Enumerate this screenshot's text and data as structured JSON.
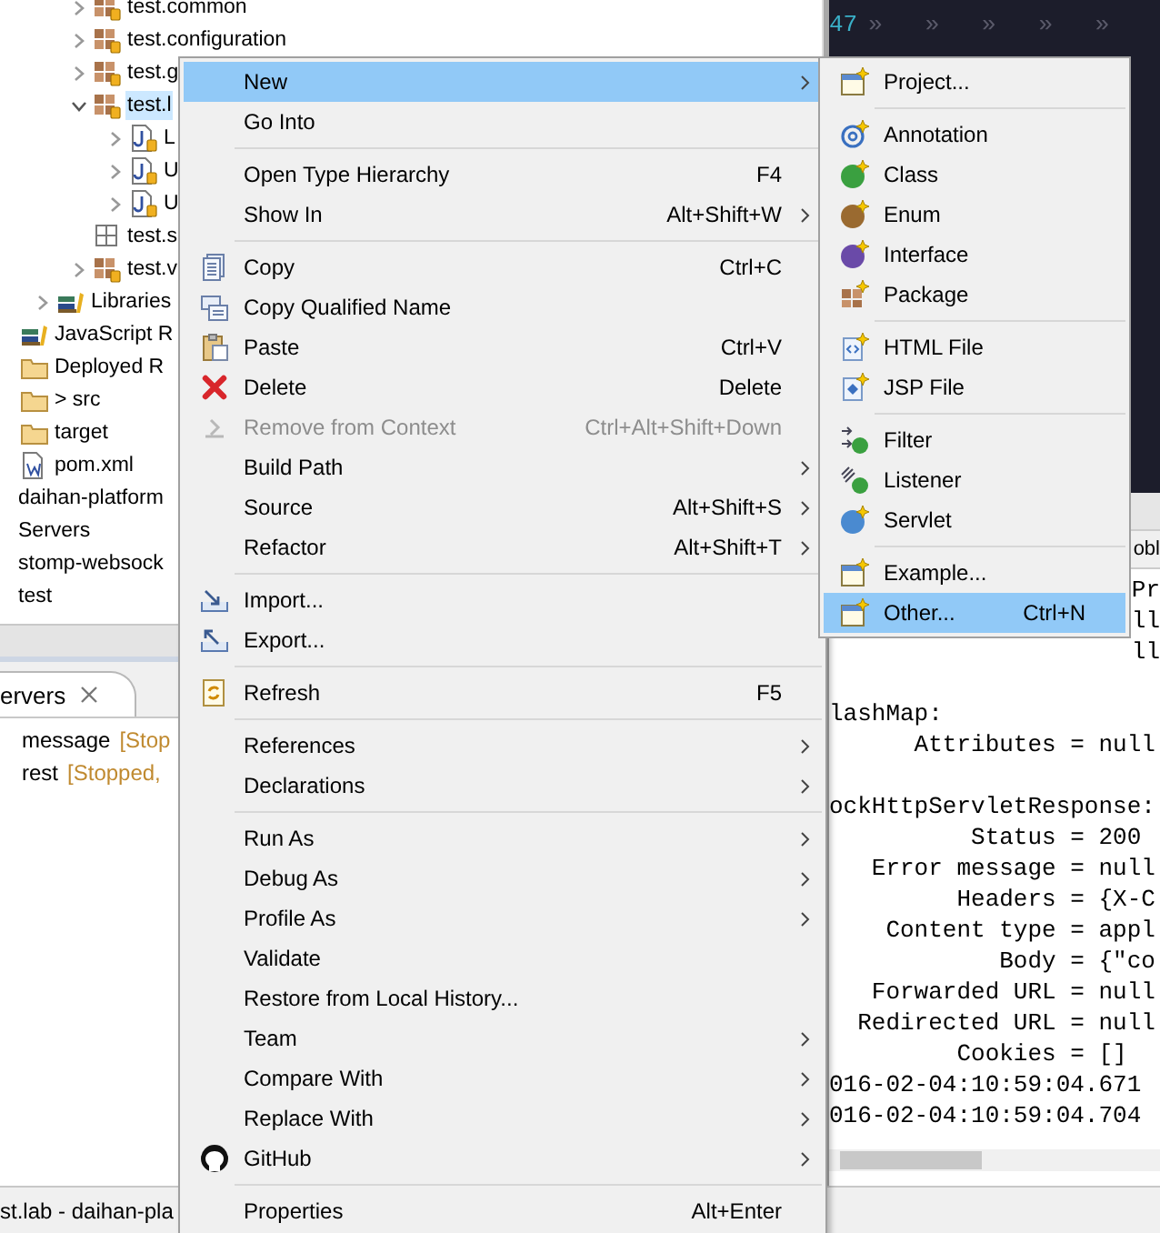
{
  "tree": [
    {
      "children": [
        {
          "children": [
            {
              "children": [
                {
                  "label": "test.common",
                  "kind": "package",
                  "expanded": false,
                  "selected": false
                },
                {
                  "label": "test.configuration",
                  "kind": "package",
                  "expanded": false,
                  "selected": false
                },
                {
                  "label": "test.g",
                  "kind": "package",
                  "expanded": false,
                  "selected": false
                },
                {
                  "label": "test.l",
                  "kind": "package",
                  "expanded": true,
                  "selected": true,
                  "children": [
                    {
                      "label": "L",
                      "kind": "source_file",
                      "expanded": false,
                      "selected": false
                    },
                    {
                      "label": "U",
                      "kind": "source_file",
                      "expanded": false,
                      "selected": false
                    },
                    {
                      "label": "U",
                      "kind": "source_file",
                      "expanded": false,
                      "selected": false
                    }
                  ]
                },
                {
                  "label": "test.s",
                  "kind": "empty_package",
                  "selected": false
                },
                {
                  "label": "test.v",
                  "kind": "package",
                  "expanded": false,
                  "selected": false
                }
              ]
            },
            {
              "label": "Libraries",
              "kind": "library",
              "expanded": false,
              "selected": false
            }
          ]
        },
        {
          "label": "JavaScript R",
          "kind": "library",
          "selected": false
        },
        {
          "label": "Deployed R",
          "kind": "folder",
          "selected": false
        },
        {
          "label": "> src",
          "kind": "folder",
          "selected": false
        },
        {
          "label": "target",
          "kind": "folder",
          "selected": false
        },
        {
          "label": "pom.xml",
          "kind": "xml_file",
          "selected": false
        }
      ]
    },
    {
      "label": "daihan-platform",
      "selected": false
    },
    {
      "label": "Servers",
      "selected": false
    },
    {
      "label": "stomp-websock",
      "selected": false
    },
    {
      "label": "test",
      "selected": false
    }
  ],
  "servers_view": {
    "tab": "ervers",
    "servers": [
      {
        "name": "message",
        "status": "[Stop"
      },
      {
        "name": "rest",
        "status": "[Stopped,"
      }
    ]
  },
  "status_bar": "st.lab - daihan-pla",
  "editor": {
    "line_number": "47",
    "text": "»   »   »   »   »"
  },
  "console": {
    "tab_label": "obl",
    "partial_lines": [
      "Pr",
      "ll",
      "ll"
    ],
    "blocks": [
      [
        "lashMap:",
        "      Attributes = null"
      ],
      [
        "ockHttpServletResponse:",
        "          Status = 200",
        "   Error message = null",
        "         Headers = {X-C",
        "    Content type = appl",
        "            Body = {\"co",
        "   Forwarded URL = null",
        "  Redirected URL = null",
        "         Cookies = []",
        "016-02-04:10:59:04.671",
        "016-02-04:10:59:04.704"
      ]
    ]
  },
  "menu": {
    "items": [
      {
        "kind": "item",
        "label": "New",
        "has_submenu": true,
        "selected": true,
        "disabled": false
      },
      {
        "kind": "item",
        "label": "Go Into",
        "has_submenu": false,
        "selected": false,
        "disabled": false
      },
      {
        "kind": "separator"
      },
      {
        "kind": "item",
        "label": "Open Type Hierarchy",
        "shortcut": "F4",
        "has_submenu": false,
        "selected": false,
        "disabled": false
      },
      {
        "kind": "item",
        "label": "Show In",
        "shortcut": "Alt+Shift+W",
        "has_submenu": true,
        "selected": false,
        "disabled": false
      },
      {
        "kind": "separator"
      },
      {
        "kind": "item",
        "label": "Copy",
        "shortcut": "Ctrl+C",
        "has_submenu": false,
        "selected": false,
        "disabled": false
      },
      {
        "kind": "item",
        "label": "Copy Qualified Name",
        "has_submenu": false,
        "selected": false,
        "disabled": false
      },
      {
        "kind": "item",
        "label": "Paste",
        "shortcut": "Ctrl+V",
        "has_submenu": false,
        "selected": false,
        "disabled": false
      },
      {
        "kind": "item",
        "label": "Delete",
        "shortcut": "Delete",
        "has_submenu": false,
        "selected": false,
        "disabled": false
      },
      {
        "kind": "item",
        "label": "Remove from Context",
        "shortcut": "Ctrl+Alt+Shift+Down",
        "has_submenu": false,
        "selected": false,
        "disabled": true
      },
      {
        "kind": "item",
        "label": "Build Path",
        "has_submenu": true,
        "selected": false,
        "disabled": false
      },
      {
        "kind": "item",
        "label": "Source",
        "shortcut": "Alt+Shift+S",
        "has_submenu": true,
        "selected": false,
        "disabled": false
      },
      {
        "kind": "item",
        "label": "Refactor",
        "shortcut": "Alt+Shift+T",
        "has_submenu": true,
        "selected": false,
        "disabled": false
      },
      {
        "kind": "separator"
      },
      {
        "kind": "item",
        "label": "Import...",
        "has_submenu": false,
        "selected": false,
        "disabled": false
      },
      {
        "kind": "item",
        "label": "Export...",
        "has_submenu": false,
        "selected": false,
        "disabled": false
      },
      {
        "kind": "separator"
      },
      {
        "kind": "item",
        "label": "Refresh",
        "shortcut": "F5",
        "has_submenu": false,
        "selected": false,
        "disabled": false
      },
      {
        "kind": "separator"
      },
      {
        "kind": "item",
        "label": "References",
        "has_submenu": true,
        "selected": false,
        "disabled": false
      },
      {
        "kind": "item",
        "label": "Declarations",
        "has_submenu": true,
        "selected": false,
        "disabled": false
      },
      {
        "kind": "separator"
      },
      {
        "kind": "item",
        "label": "Run As",
        "has_submenu": true,
        "selected": false,
        "disabled": false
      },
      {
        "kind": "item",
        "label": "Debug As",
        "has_submenu": true,
        "selected": false,
        "disabled": false
      },
      {
        "kind": "item",
        "label": "Profile As",
        "has_submenu": true,
        "selected": false,
        "disabled": false
      },
      {
        "kind": "item",
        "label": "Validate",
        "has_submenu": false,
        "selected": false,
        "disabled": false
      },
      {
        "kind": "item",
        "label": "Restore from Local History...",
        "has_submenu": false,
        "selected": false,
        "disabled": false
      },
      {
        "kind": "item",
        "label": "Team",
        "has_submenu": true,
        "selected": false,
        "disabled": false
      },
      {
        "kind": "item",
        "label": "Compare With",
        "has_submenu": true,
        "selected": false,
        "disabled": false
      },
      {
        "kind": "item",
        "label": "Replace With",
        "has_submenu": true,
        "selected": false,
        "disabled": false
      },
      {
        "kind": "item",
        "label": "GitHub",
        "has_submenu": true,
        "selected": false,
        "disabled": false
      },
      {
        "kind": "separator"
      },
      {
        "kind": "item",
        "label": "Properties",
        "shortcut": "Alt+Enter",
        "has_submenu": false,
        "selected": false,
        "disabled": false
      }
    ]
  },
  "submenu": {
    "items": [
      {
        "kind": "item",
        "label": "Project...",
        "selected": false
      },
      {
        "kind": "separator"
      },
      {
        "kind": "item",
        "label": "Annotation",
        "selected": false
      },
      {
        "kind": "item",
        "label": "Class",
        "selected": false
      },
      {
        "kind": "item",
        "label": "Enum",
        "selected": false
      },
      {
        "kind": "item",
        "label": "Interface",
        "selected": false
      },
      {
        "kind": "item",
        "label": "Package",
        "selected": false
      },
      {
        "kind": "separator"
      },
      {
        "kind": "item",
        "label": "HTML File",
        "selected": false
      },
      {
        "kind": "item",
        "label": "JSP File",
        "selected": false
      },
      {
        "kind": "separator"
      },
      {
        "kind": "item",
        "label": "Filter",
        "selected": false
      },
      {
        "kind": "item",
        "label": "Listener",
        "selected": false
      },
      {
        "kind": "item",
        "label": "Servlet",
        "selected": false
      },
      {
        "kind": "separator"
      },
      {
        "kind": "item",
        "label": "Example...",
        "selected": false
      },
      {
        "kind": "item",
        "label": "Other...",
        "shortcut": "Ctrl+N",
        "selected": true
      }
    ]
  }
}
